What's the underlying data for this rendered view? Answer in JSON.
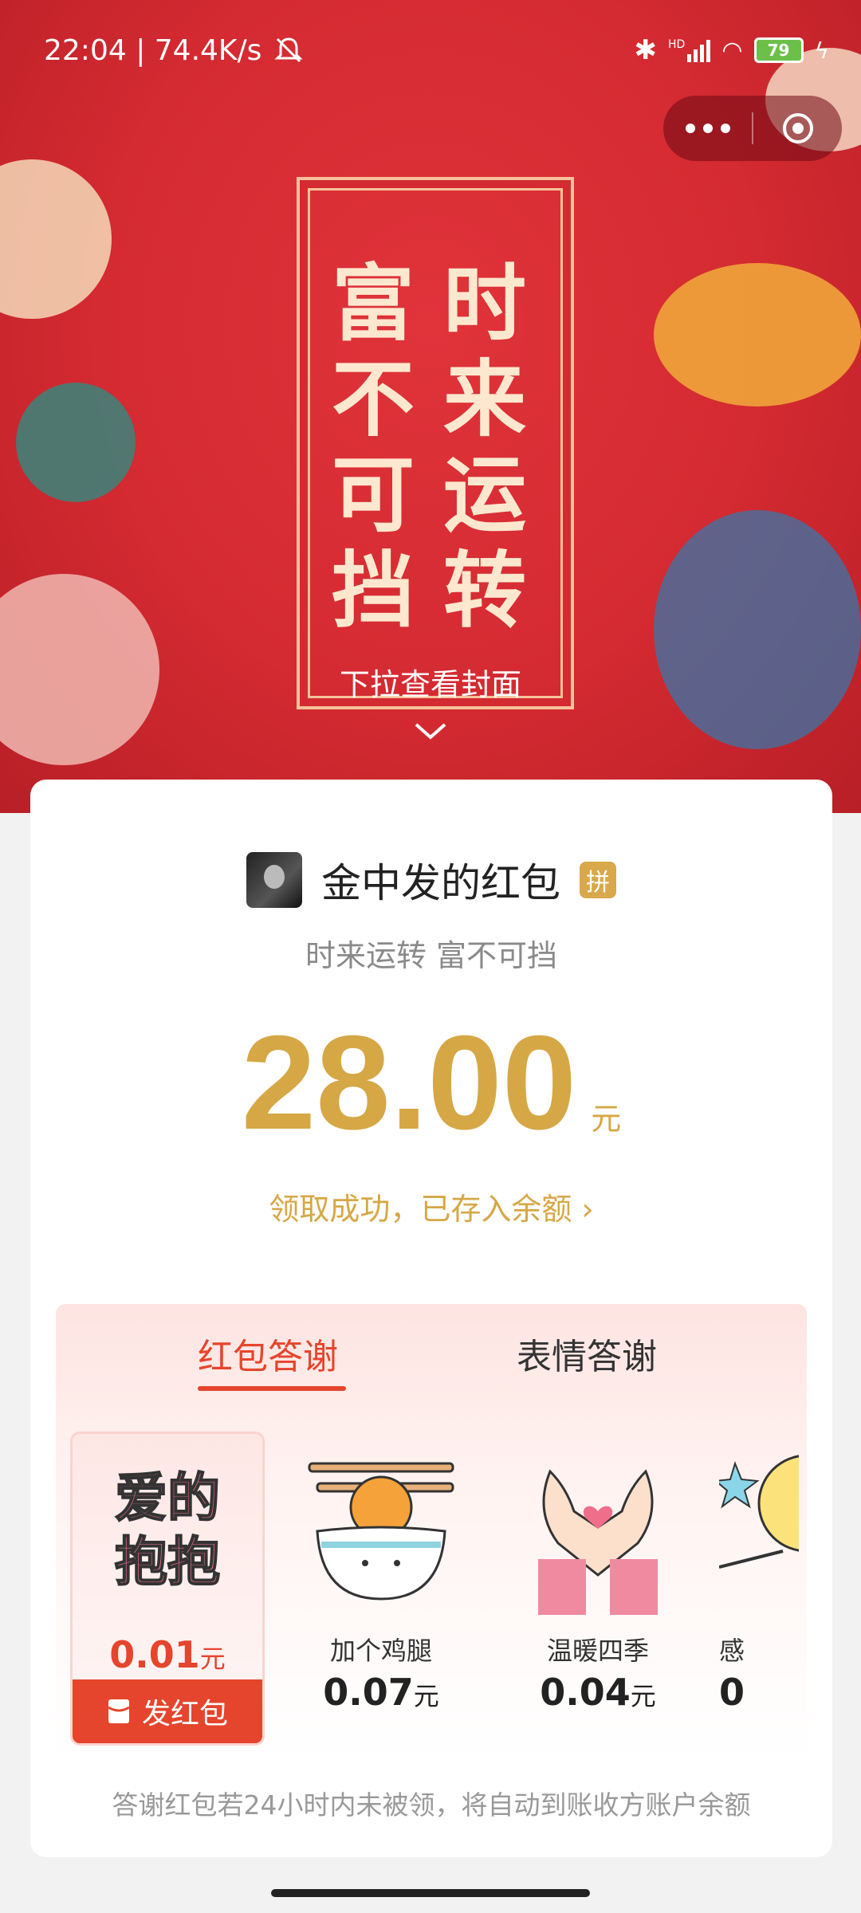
{
  "status_bar": {
    "time_speed": "22:04 | 74.4K/s",
    "battery": "79",
    "network": "HD"
  },
  "banner": {
    "cover_left_col": [
      "富",
      "不",
      "可",
      "挡"
    ],
    "cover_right_col": [
      "时",
      "来",
      "运",
      "转"
    ],
    "pull_hint": "下拉查看封面"
  },
  "card": {
    "sender_name": "金中发的红包",
    "pin_badge": "拼",
    "greeting": "时来运转 富不可挡",
    "amount": "28.00",
    "amount_unit": "元",
    "received_text": "领取成功，已存入余额 ›"
  },
  "thanks": {
    "tabs": [
      "红包答谢",
      "表情答谢"
    ],
    "selected_gift": {
      "art_text_line1": "爱的",
      "art_text_line2": "抱抱",
      "price": "0.01",
      "unit": "元",
      "send_label": "发红包"
    },
    "gifts": [
      {
        "name": "加个鸡腿",
        "price": "0.07",
        "unit": "元"
      },
      {
        "name": "温暖四季",
        "price": "0.04",
        "unit": "元"
      },
      {
        "name": "感",
        "price": "0",
        "unit": ""
      }
    ],
    "note": "答谢红包若24小时内未被领，将自动到账收方账户余额"
  },
  "colors": {
    "banner_red": "#d42a31",
    "gold": "#d6a745",
    "accent_red": "#e5452c"
  }
}
